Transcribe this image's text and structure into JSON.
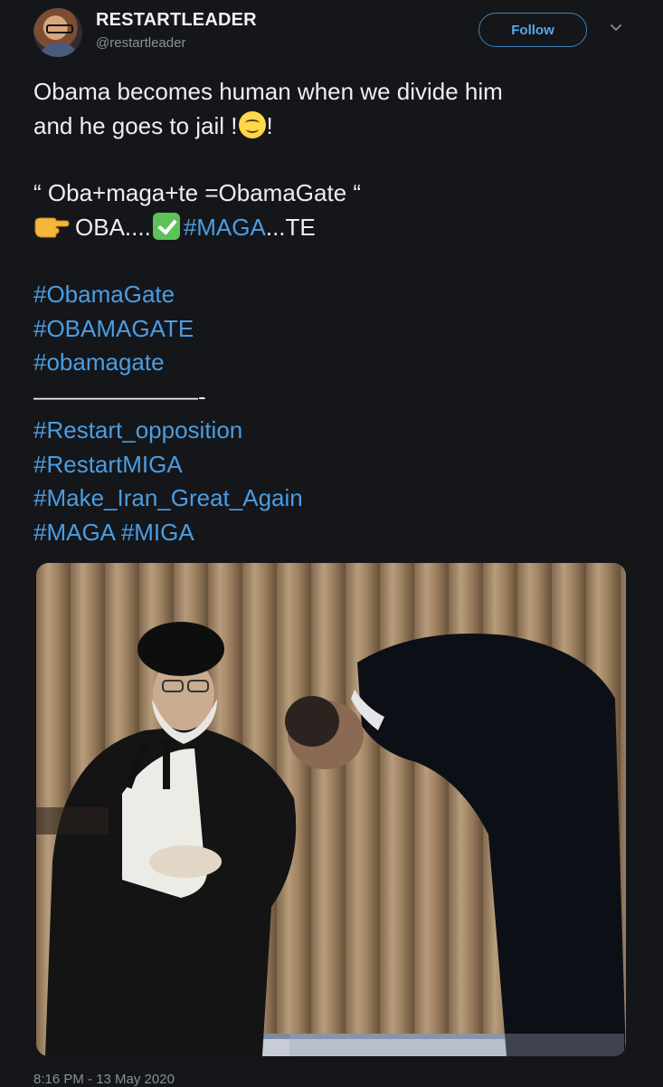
{
  "tweet": {
    "author_name": "RESTARTLEADER",
    "author_handle": "@restartleader",
    "follow_label": "Follow",
    "lines": [
      "Obama becomes human when we divide him",
      "and he goes to jail !",
      "!",
      "“ Oba+maga+te =ObamaGate “",
      "OBA....",
      "#MAGA",
      "...TE",
      "#ObamaGate",
      "#OBAMAGATE",
      "#obamagate",
      "———————-",
      "#Restart_opposition",
      "#RestartMIGA",
      "#Make_Iran_Great_Again",
      "#MAGA #MIGA"
    ],
    "timestamp": "8:16 PM - 13 May 2020"
  },
  "icons": {
    "avatar": "profile-photo",
    "caret": "chevron-down-icon",
    "smile": "smiling-face-emoji",
    "pointing": "backhand-index-pointing-right-emoji",
    "check": "check-mark-button-emoji"
  },
  "colors": {
    "background": "#15161a",
    "hashtag": "#4a9de2",
    "follow_border": "#3f7fb8",
    "muted_text": "#8b8f98"
  }
}
